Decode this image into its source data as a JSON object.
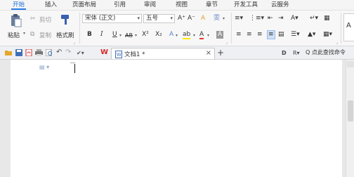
{
  "menu_tabs": [
    "开始",
    "插入",
    "页面布局",
    "引用",
    "审阅",
    "视图",
    "章节",
    "开发工具",
    "云服务"
  ],
  "clipboard": {
    "paste": "粘贴",
    "cut": "剪切",
    "copy": "复制",
    "format_painter": "格式刷"
  },
  "font": {
    "name": "宋体 (正文)",
    "size": "五号",
    "grow": "A⁺",
    "shrink": "A⁻",
    "clear": "A",
    "phonetic": "雯",
    "bold": "B",
    "italic": "I",
    "underline": "U",
    "strikethrough": "AB",
    "superscript": "X²",
    "subscript": "X₂",
    "text_effect": "A",
    "highlight": "ab",
    "font_color": "A",
    "char_shading": "A"
  },
  "paragraph": {
    "row1": [
      "≡▾",
      "⋮≡▾",
      "⇤",
      "⇥",
      "A▾",
      "↵▾",
      "▦"
    ],
    "row2": [
      "≡",
      "≡",
      "≡",
      "≡",
      "▤",
      "☰▾",
      "▲▾",
      "▦▾"
    ],
    "styles_cut": "A"
  },
  "quick_access": {
    "icons": [
      "open-icon",
      "save-icon",
      "pdf-icon",
      "print-icon",
      "print-preview-icon",
      "undo-icon",
      "redo-icon",
      "wps-logo-icon"
    ],
    "doc_tab_name": "文档1 *",
    "close": "×",
    "new_tab": "+",
    "right_icons": [
      "D",
      "R▾"
    ],
    "search_label": "Q 点此查找命令"
  },
  "colors": {
    "accent": "#2b7ce9",
    "highlight_yellow": "#ffe600",
    "font_red": "#e23b2e",
    "wps_red": "#d8262b"
  }
}
